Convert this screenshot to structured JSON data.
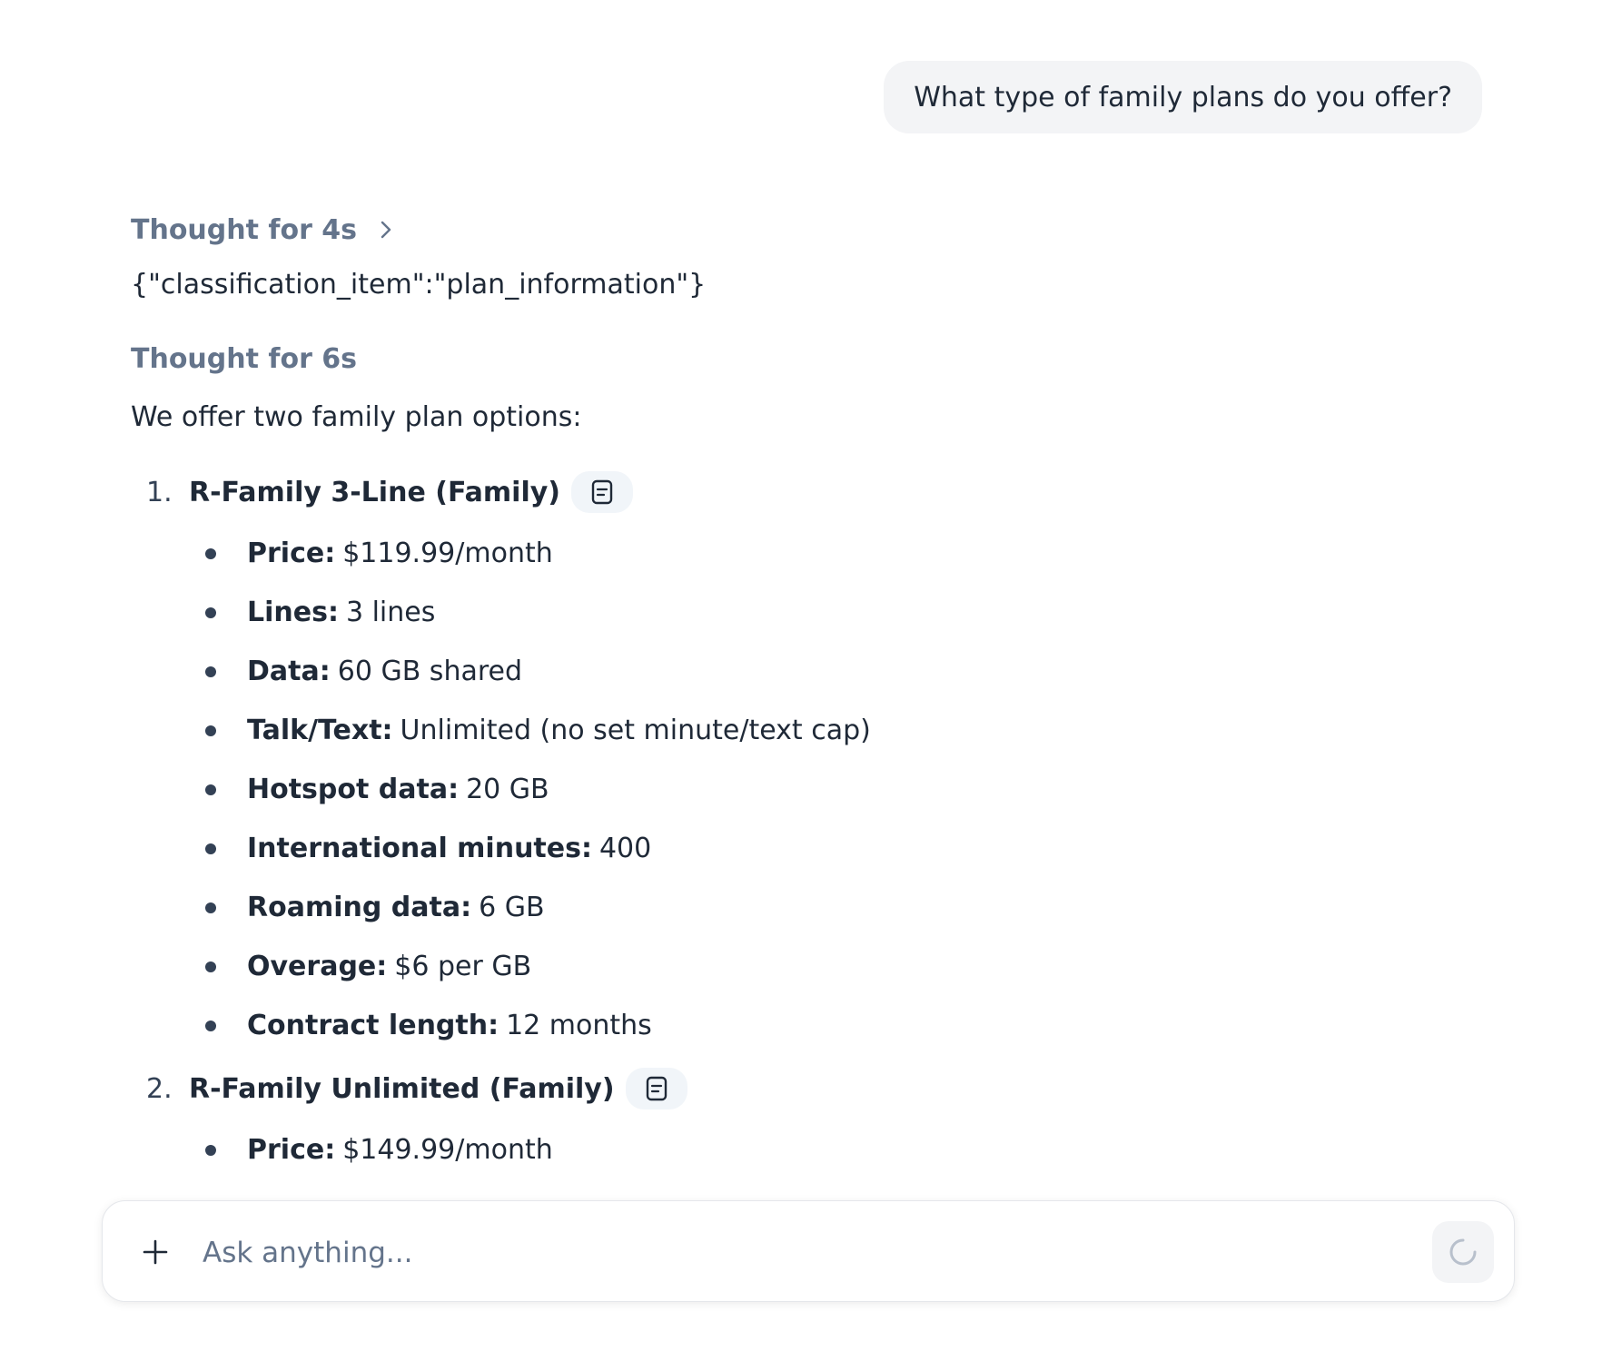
{
  "user_message": "What type of family plans do you offer?",
  "assistant": {
    "thought1_label": "Thought for 4s",
    "classification": "{\"classification_item\":\"plan_information\"}",
    "thought2_label": "Thought for 6s",
    "intro": "We offer two family plan options:",
    "plans": [
      {
        "number": "1.",
        "title": "R-Family 3-Line (Family)",
        "details": [
          {
            "key": "Price:",
            "value": "$119.99/month"
          },
          {
            "key": "Lines:",
            "value": "3 lines"
          },
          {
            "key": "Data:",
            "value": "60 GB shared"
          },
          {
            "key": "Talk/Text:",
            "value": "Unlimited (no set minute/text cap)"
          },
          {
            "key": "Hotspot data:",
            "value": "20 GB"
          },
          {
            "key": "International minutes:",
            "value": "400"
          },
          {
            "key": "Roaming data:",
            "value": "6 GB"
          },
          {
            "key": "Overage:",
            "value": "$6 per GB"
          },
          {
            "key": "Contract length:",
            "value": "12 months"
          }
        ]
      },
      {
        "number": "2.",
        "title": "R-Family Unlimited (Family)",
        "details": [
          {
            "key": "Price:",
            "value": "$149.99/month"
          }
        ]
      }
    ]
  },
  "composer": {
    "placeholder": "Ask anything...",
    "plus_icon": "plus-icon",
    "send_icon": "loading-spinner-icon"
  },
  "icons": {
    "thought_chevron": "chevron-right-icon",
    "source_chip": "document-icon"
  },
  "colors": {
    "user_bubble_bg": "#f3f4f6",
    "thought_text": "#64748b",
    "body_text": "#1f2937",
    "chip_bg": "#f1f5f9"
  }
}
